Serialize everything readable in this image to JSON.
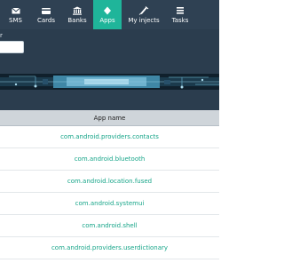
{
  "colors": {
    "nav_background": "#2f4153",
    "nav_active": "#1fb59a",
    "link": "#17a589",
    "table_header": "#cfd5da"
  },
  "nav": {
    "items": [
      {
        "label": "SMS",
        "icon": "envelope-icon",
        "active": false
      },
      {
        "label": "Cards",
        "icon": "credit-card-icon",
        "active": false
      },
      {
        "label": "Banks",
        "icon": "bank-icon",
        "active": false
      },
      {
        "label": "Apps",
        "icon": "diamond-icon",
        "active": true
      },
      {
        "label": "My injects",
        "icon": "syringe-icon",
        "active": false
      },
      {
        "label": "Tasks",
        "icon": "tasks-icon",
        "active": false
      }
    ]
  },
  "filter": {
    "label": "r",
    "value": ""
  },
  "table": {
    "header": "App name",
    "rows": [
      "com.android.providers.contacts",
      "com.android.bluetooth",
      "com.android.location.fused",
      "com.android.systemui",
      "com.android.shell",
      "com.android.providers.userdictionary"
    ]
  }
}
